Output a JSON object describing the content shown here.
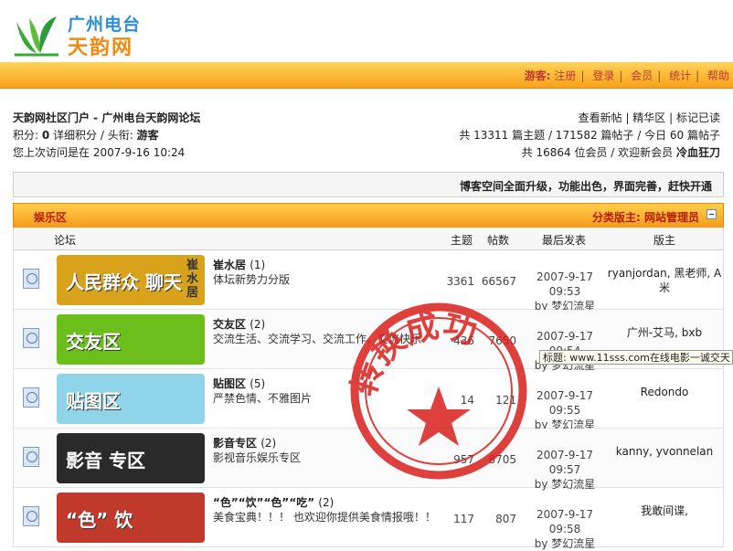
{
  "logo": {
    "line1": "广州电台",
    "line2": "天韵网"
  },
  "nav": {
    "guest_label": "游客:",
    "items": [
      "注册",
      "登录",
      "会员",
      "统计",
      "帮助"
    ]
  },
  "breadcrumb": "天韵网社区门户 - 广州电台天韵网论坛",
  "user": {
    "points_label": "积分: ",
    "points": "0",
    "points_detail": " 详细积分",
    "title_label": " / 头衔: ",
    "title": "游客"
  },
  "last_visit": "您上次访问是在 2007-9-16 10:24",
  "quick_links": [
    "查看新帖",
    "精华区",
    "标记已读"
  ],
  "stats": {
    "line1": "共 13311 篇主题 / 171582 篇帖子 / 今日 60 篇帖子",
    "line2_prefix": "共 16864 位会员 / 欢迎新会员 ",
    "newest_member": "冷血狂刀"
  },
  "announcement": "博客空间全面升级，功能出色，界面完善，赶快开通",
  "category": {
    "title": "娱乐区",
    "moderator_label": "分类版主: 网站管理员"
  },
  "table_headers": {
    "forum": "论坛",
    "topics": "主题",
    "posts": "帖数",
    "last_post": "最后发表",
    "moderator": "版主"
  },
  "forums": [
    {
      "name": "崔水居",
      "new_count": "(1)",
      "desc": "体坛新势力分版",
      "topics": "3361",
      "posts": "66567",
      "last_date": "2007-9-17 09:53",
      "last_by": "by 梦幻流星",
      "mods": "ryanjordan, 黑老师, A米",
      "banner_text": "人民群众 聊天",
      "banner_side": "崔水居",
      "banner_bg": "#d8a21a"
    },
    {
      "name": "交友区",
      "new_count": "(2)",
      "desc": "交流生活、交流学习、交流工作、交流快乐",
      "topics": "436",
      "posts": "7650",
      "last_date": "2007-9-17 09:54",
      "last_by": "by 梦幻流星",
      "mods": "广州-艾马, bxb",
      "banner_text": "交友区",
      "banner_side": "",
      "banner_bg": "#6cbf1a"
    },
    {
      "name": "贴图区",
      "new_count": "(5)",
      "desc": "严禁色情、不雅图片",
      "topics": "14",
      "posts": "121",
      "last_date": "2007-9-17 09:55",
      "last_by": "by 梦幻流星",
      "mods": "Redondo",
      "banner_text": "贴图区",
      "banner_side": "",
      "banner_bg": "#8fd4e8"
    },
    {
      "name": "影音专区",
      "new_count": "(2)",
      "desc": "影视音乐娱乐专区",
      "topics": "957",
      "posts": "8705",
      "last_date": "2007-9-17 09:57",
      "last_by": "by 梦幻流星",
      "mods": "kanny, yvonnelan",
      "banner_text": "影音 专区",
      "banner_side": "",
      "banner_bg": "#2a2a2a"
    },
    {
      "name": "“色”“饮”“色”“吃”",
      "new_count": "(2)",
      "desc": "美食宝典！！！ 也欢迎你提供美食情报哦！！",
      "topics": "117",
      "posts": "807",
      "last_date": "2007-9-17 09:58",
      "last_by": "by 梦幻流星",
      "mods": "我敢间谍,",
      "banner_text": "“色” 饮",
      "banner_side": "",
      "banner_bg": "#c0392b"
    }
  ],
  "tooltip": "标题: www.11sss.com在线电影一诚交天",
  "stamp_text": "转换成功",
  "colors": {
    "accent": "#f7a21a",
    "link_red": "#c0392b",
    "stamp": "#d9201c"
  }
}
